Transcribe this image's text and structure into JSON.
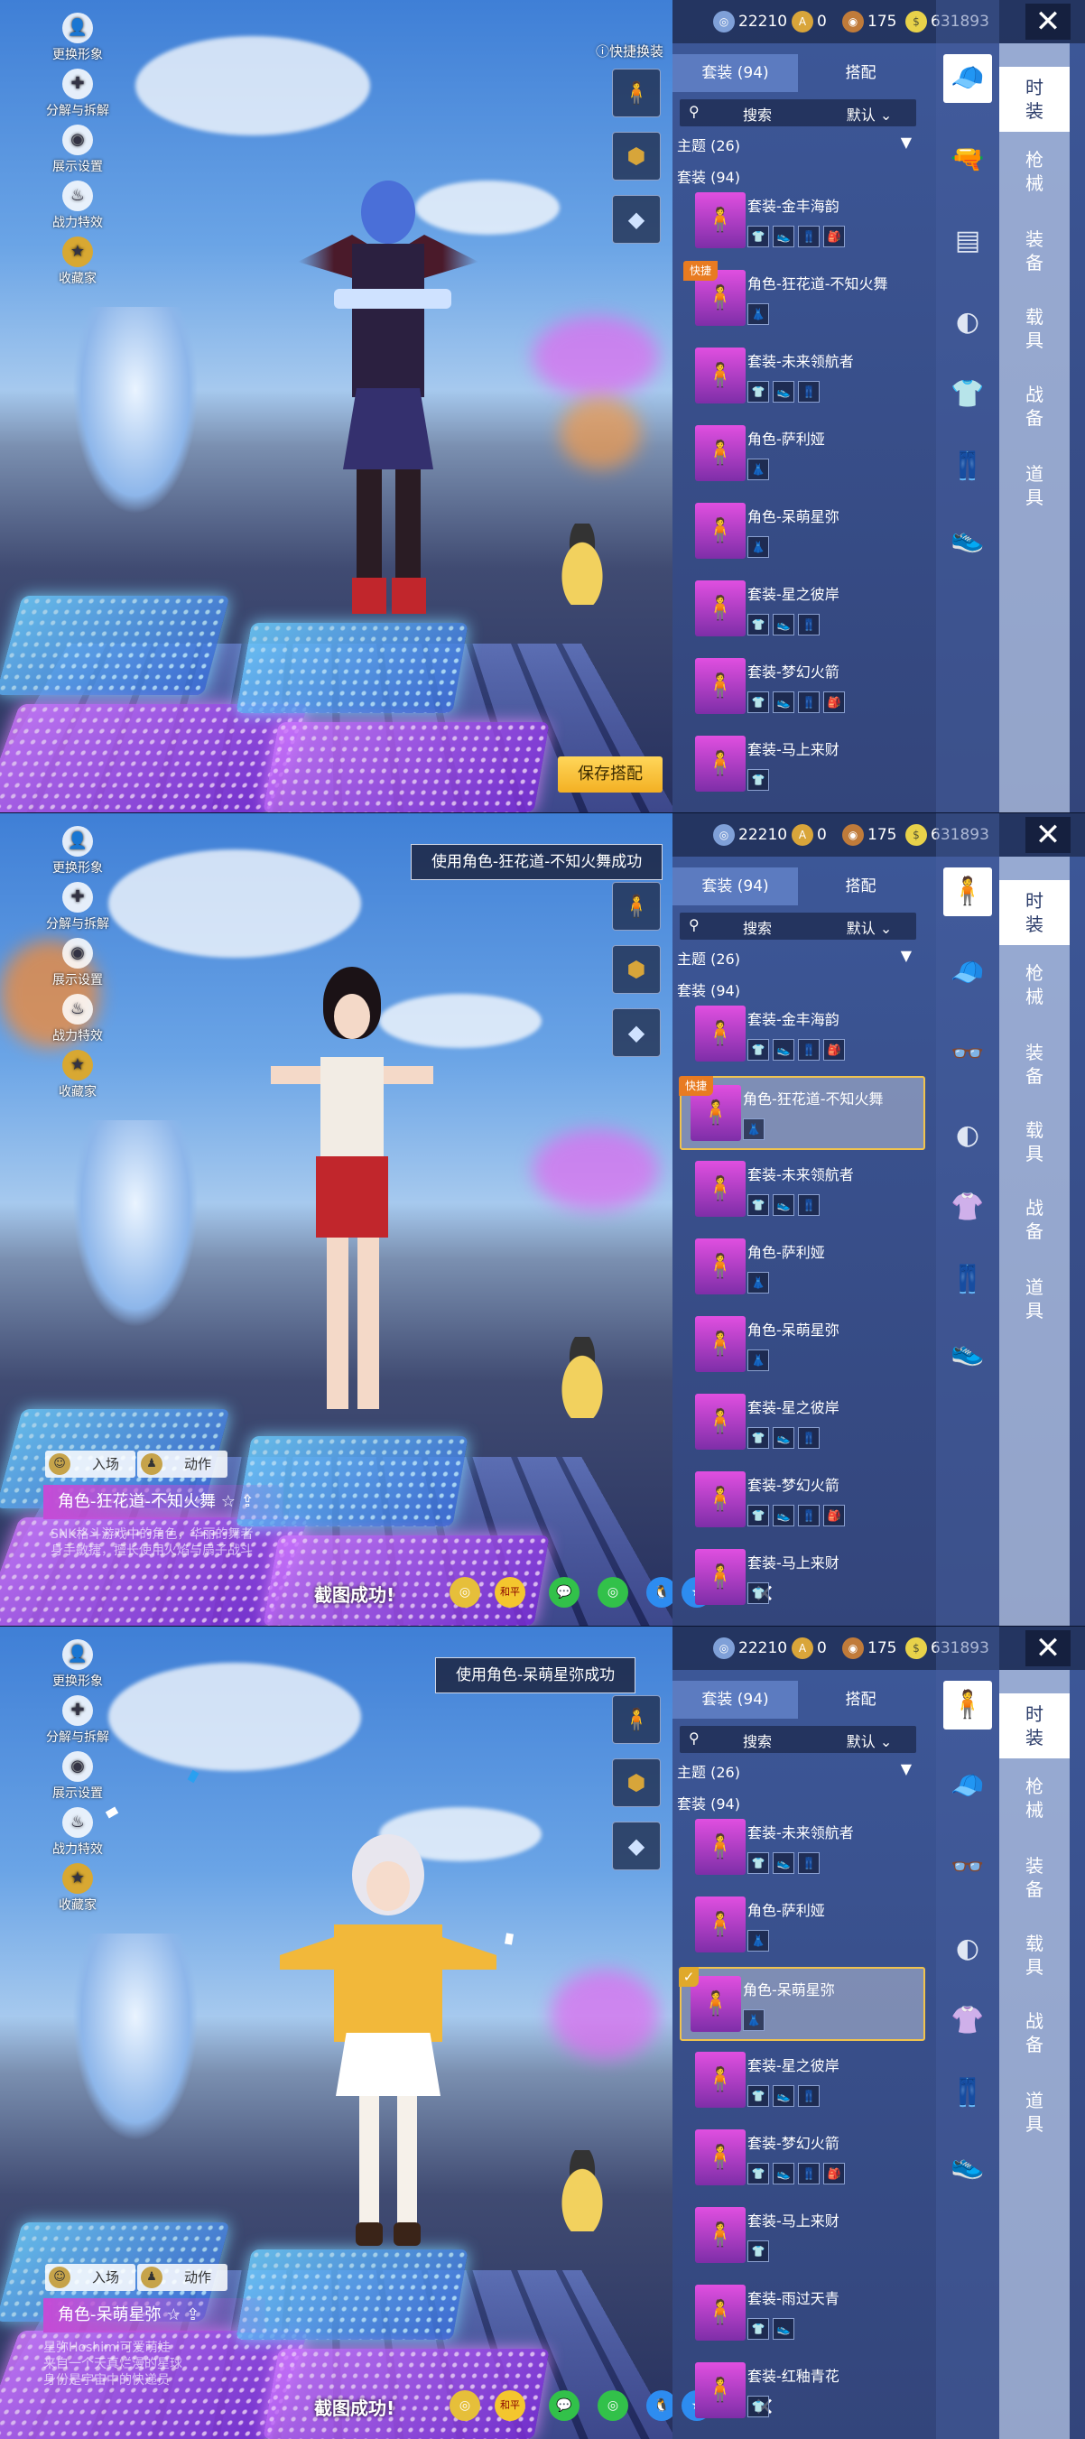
{
  "currency": [
    {
      "icon": "silver-coin-icon",
      "value": "22210",
      "color": "#7fa0d8"
    },
    {
      "icon": "ag-token-icon",
      "value": "0",
      "color": "#d9a53a"
    },
    {
      "icon": "bp-coin-icon",
      "value": "175",
      "color": "#c07b3a"
    },
    {
      "icon": "uc-coin-icon",
      "value": "631893",
      "color": "#e8d24a"
    }
  ],
  "left_menu": [
    "更换形象",
    "分解与拆解",
    "展示设置",
    "战力特效",
    "收藏家"
  ],
  "quick_swap_label": "快捷换装",
  "tabs": {
    "suits": "套装 (94)",
    "match": "搭配"
  },
  "search": {
    "label": "搜索",
    "sort": "默认"
  },
  "theme_header": "主题 (26)",
  "suit_header": "套装 (94)",
  "save_label": "保存搭配",
  "quick_badge": "快捷",
  "categories": [
    "时\n装",
    "枪\n械",
    "装\n备",
    "载\n具",
    "战\n备",
    "道\n具"
  ],
  "panel1": {
    "items": [
      {
        "name": "套装-金丰海韵",
        "icons": [
          "👕",
          "👟",
          "👖",
          "🎒"
        ]
      },
      {
        "name": "角色-狂花道-不知火舞",
        "icons": [
          "👗"
        ],
        "quick": true
      },
      {
        "name": "套装-未来领航者",
        "icons": [
          "👕",
          "👟",
          "👖"
        ]
      },
      {
        "name": "角色-萨利娅",
        "icons": [
          "👗"
        ]
      },
      {
        "name": "角色-呆萌星弥",
        "icons": [
          "👗"
        ]
      },
      {
        "name": "套装-星之彼岸",
        "icons": [
          "👕",
          "👟",
          "👖"
        ]
      },
      {
        "name": "套装-梦幻火箭",
        "icons": [
          "👕",
          "👟",
          "👖",
          "🎒"
        ]
      },
      {
        "name": "套装-马上来财",
        "icons": [
          "👕"
        ]
      }
    ]
  },
  "panel2": {
    "toast": "使用角色-狂花道-不知火舞成功",
    "action_enter": "入场",
    "action_motion": "动作",
    "char_name": "角色-狂花道-不知火舞",
    "desc": "SNK格斗游戏中的角色，华丽的舞者\n身手敏捷，擅长使用火焰与扇子战斗",
    "shot_text": "截图成功!",
    "items": [
      {
        "name": "套装-金丰海韵",
        "icons": [
          "👕",
          "👟",
          "👖",
          "🎒"
        ]
      },
      {
        "name": "角色-狂花道-不知火舞",
        "icons": [
          "👗"
        ],
        "quick": true,
        "selected": true
      },
      {
        "name": "套装-未来领航者",
        "icons": [
          "👕",
          "👟",
          "👖"
        ]
      },
      {
        "name": "角色-萨利娅",
        "icons": [
          "👗"
        ]
      },
      {
        "name": "角色-呆萌星弥",
        "icons": [
          "👗"
        ]
      },
      {
        "name": "套装-星之彼岸",
        "icons": [
          "👕",
          "👟",
          "👖"
        ]
      },
      {
        "name": "套装-梦幻火箭",
        "icons": [
          "👕",
          "👟",
          "👖",
          "🎒"
        ]
      },
      {
        "name": "套装-马上来财",
        "icons": [
          "👕"
        ]
      }
    ]
  },
  "panel3": {
    "toast": "使用角色-呆萌星弥成功",
    "action_enter": "入场",
    "action_motion": "动作",
    "char_name": "角色-呆萌星弥",
    "desc": "星弥Hoshimi可爱萌娃\n来自一个天真烂漫的星球\n身份是宇宙中的快递员",
    "shot_text": "截图成功!",
    "items": [
      {
        "name": "套装-未来领航者",
        "icons": [
          "👕",
          "👟",
          "👖"
        ]
      },
      {
        "name": "角色-萨利娅",
        "icons": [
          "👗"
        ]
      },
      {
        "name": "角色-呆萌星弥",
        "icons": [
          "👗"
        ],
        "selected": true,
        "checked": true
      },
      {
        "name": "套装-星之彼岸",
        "icons": [
          "👕",
          "👟",
          "👖"
        ]
      },
      {
        "name": "套装-梦幻火箭",
        "icons": [
          "👕",
          "👟",
          "👖",
          "🎒"
        ]
      },
      {
        "name": "套装-马上来财",
        "icons": [
          "👕"
        ]
      },
      {
        "name": "套装-雨过天青",
        "icons": [
          "👕",
          "👟"
        ]
      },
      {
        "name": "套装-红釉青花",
        "icons": [
          "👕"
        ]
      }
    ]
  }
}
